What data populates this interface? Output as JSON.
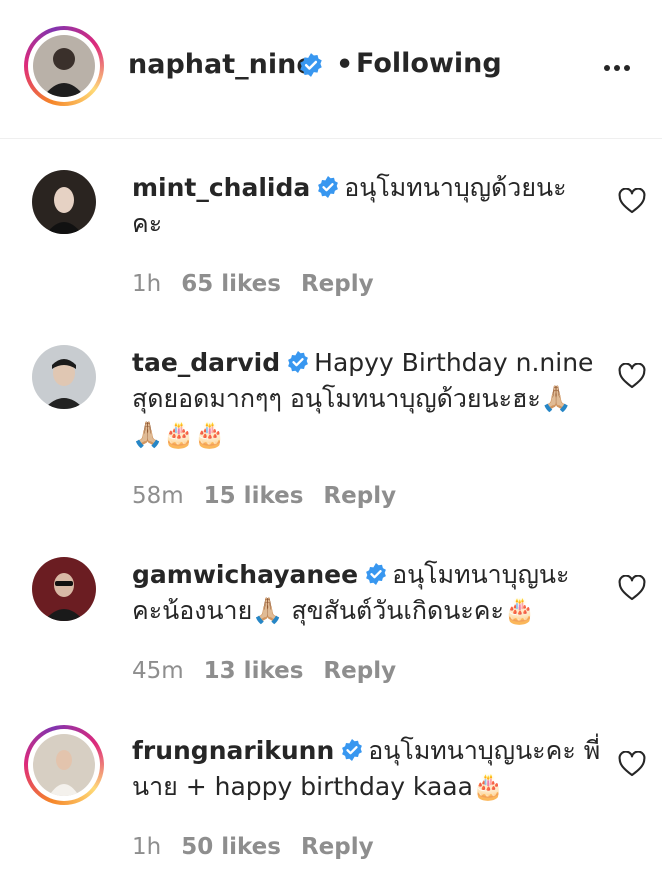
{
  "header": {
    "username": "naphat_nine",
    "separator": "•",
    "follow_status": "Following",
    "more_icon": "more-horizontal-icon"
  },
  "comments": [
    {
      "username": "mint_chalida",
      "text": "อนุโมทนาบุญด้วยนะ คะ",
      "time": "1h",
      "likes": "65 likes",
      "reply": "Reply"
    },
    {
      "username": "tae_darvid",
      "text": "Hapyy Birthday n.nine สุดยอดมากๆๆ อนุโมทนาบุญด้วยนะฮะ🙏🏼🙏🏼🎂🎂",
      "time": "58m",
      "likes": "15 likes",
      "reply": "Reply"
    },
    {
      "username": "gamwichayanee",
      "text": "อนุโมทนาบุญนะ คะน้องนาย🙏🏼 สุขสันต์วันเกิดนะคะ🎂",
      "time": "45m",
      "likes": "13 likes",
      "reply": "Reply"
    },
    {
      "username": "frungnarikunn",
      "text": "อนุโมทนาบุญนะคะ พี่นาย + happy birthday kaaa🎂",
      "time": "1h",
      "likes": "50 likes",
      "reply": "Reply"
    }
  ],
  "colors": {
    "verified": "#3897f0",
    "text": "#262626",
    "secondary": "#8e8e8e"
  }
}
